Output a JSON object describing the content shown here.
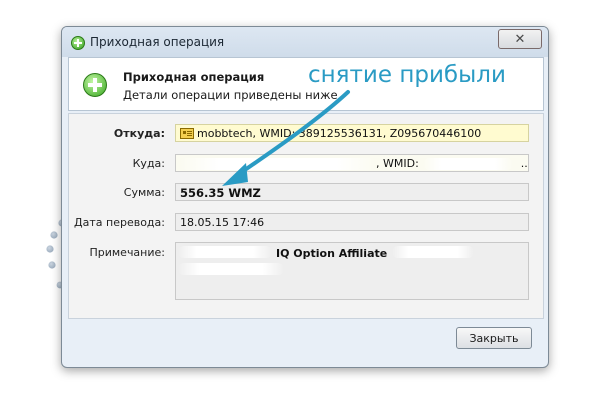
{
  "window": {
    "title": "Приходная операция",
    "close_symbol": "✕"
  },
  "header": {
    "title": "Приходная операция",
    "subtitle": "Детали операции приведены ниже"
  },
  "form": {
    "from_label": "Откуда:",
    "from_value": "mobbtech, WMID: 389125536131, Z095670446100",
    "to_label": "Куда:",
    "to_wmid_label": ", WMID:",
    "to_ellipsis": "...",
    "amount_label": "Сумма:",
    "amount_value": "556.35 WMZ",
    "date_label": "Дата перевода:",
    "date_value": "18.05.15 17:46",
    "note_label": "Примечание:",
    "note_value": "IQ Option Affiliate"
  },
  "buttons": {
    "close_label": "Закрыть"
  },
  "annotation": {
    "text": "снятие прибыли",
    "color": "#2a9bc4"
  },
  "icons": {
    "title_icon": "green-plus-circle-icon",
    "header_icon": "green-plus-circle-icon",
    "wm_icon": "webmoney-id-card-icon"
  }
}
